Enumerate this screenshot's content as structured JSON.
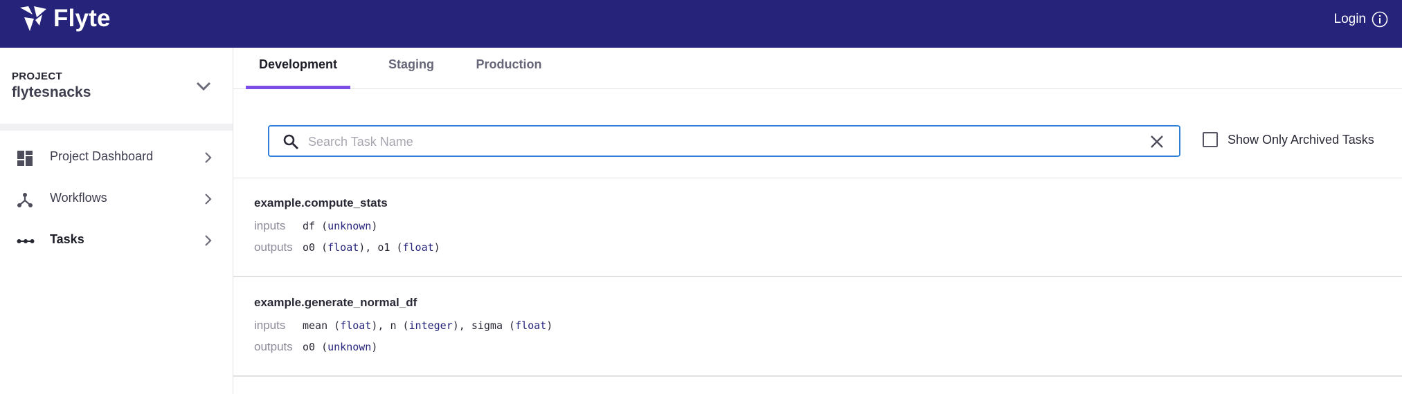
{
  "header": {
    "brand": "Flyte",
    "login_label": "Login"
  },
  "sidebar": {
    "project_caption": "PROJECT",
    "project_name": "flytesnacks",
    "items": [
      {
        "label": "Project Dashboard",
        "icon": "dashboard-icon"
      },
      {
        "label": "Workflows",
        "icon": "workflow-icon"
      },
      {
        "label": "Tasks",
        "icon": "tasks-icon",
        "active": true
      }
    ]
  },
  "tabs": [
    {
      "label": "Development",
      "active": true
    },
    {
      "label": "Staging"
    },
    {
      "label": "Production"
    }
  ],
  "search": {
    "placeholder": "Search Task Name",
    "value": ""
  },
  "archive_toggle": {
    "label": "Show Only Archived Tasks",
    "checked": false
  },
  "tasks": [
    {
      "name": "example.compute_stats",
      "inputs_label": "inputs",
      "outputs_label": "outputs",
      "inputs": [
        {
          "name": "df",
          "type": "unknown"
        }
      ],
      "outputs": [
        {
          "name": "o0",
          "type": "float"
        },
        {
          "name": "o1",
          "type": "float"
        }
      ]
    },
    {
      "name": "example.generate_normal_df",
      "inputs_label": "inputs",
      "outputs_label": "outputs",
      "inputs": [
        {
          "name": "mean",
          "type": "float"
        },
        {
          "name": "n",
          "type": "integer"
        },
        {
          "name": "sigma",
          "type": "float"
        }
      ],
      "outputs": [
        {
          "name": "o0",
          "type": "unknown"
        }
      ]
    }
  ],
  "colors": {
    "header_bg": "#25237a",
    "accent_tab": "#7b4ee8",
    "search_border": "#2f7fd8"
  }
}
